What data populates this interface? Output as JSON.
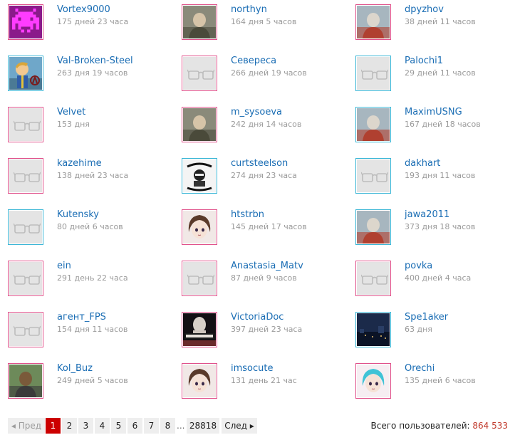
{
  "users": [
    {
      "name": "Vortex9000",
      "since": "175 дней 23 часа",
      "avatar": "pixel-invader-avatar",
      "ring": "pink"
    },
    {
      "name": "northyn",
      "since": "164 дня 5 часов",
      "avatar": "photo-avatar",
      "ring": "pink"
    },
    {
      "name": "dpyzhov",
      "since": "38 дней 11 часов",
      "avatar": "photo-avatar",
      "ring": "pink"
    },
    {
      "name": "Val-Broken-Steel",
      "since": "263 дня 19 часов",
      "avatar": "vault-boy-avatar",
      "ring": "blue"
    },
    {
      "name": "Севереса",
      "since": "266 дней 19 часов",
      "avatar": "placeholder-glasses",
      "ring": "pink"
    },
    {
      "name": "Palochi1",
      "since": "29 дней 11 часов",
      "avatar": "placeholder-glasses",
      "ring": "blue"
    },
    {
      "name": "Velvet",
      "since": "153 дня",
      "avatar": "placeholder-glasses",
      "ring": "pink"
    },
    {
      "name": "m_sysoeva",
      "since": "242 дня 14 часов",
      "avatar": "photo-avatar",
      "ring": "pink"
    },
    {
      "name": "MaximUSNG",
      "since": "167 дней 18 часов",
      "avatar": "photo-avatar",
      "ring": "blue"
    },
    {
      "name": "kazehime",
      "since": "138 дней 23 часа",
      "avatar": "placeholder-glasses",
      "ring": "pink"
    },
    {
      "name": "curtsteelson",
      "since": "274 дня 23 часа",
      "avatar": "poster-avatar",
      "ring": "blue"
    },
    {
      "name": "dakhart",
      "since": "193 дня 11 часов",
      "avatar": "placeholder-glasses",
      "ring": "blue"
    },
    {
      "name": "Kutensky",
      "since": "80 дней 6 часов",
      "avatar": "placeholder-glasses",
      "ring": "blue"
    },
    {
      "name": "htstrbn",
      "since": "145 дней 17 часов",
      "avatar": "anime-avatar",
      "ring": "pink"
    },
    {
      "name": "jawa2011",
      "since": "373 дня 18 часов",
      "avatar": "photo-avatar",
      "ring": "blue"
    },
    {
      "name": "ein",
      "since": "291 день 22 часа",
      "avatar": "placeholder-glasses",
      "ring": "pink"
    },
    {
      "name": "Anastasia_Matv",
      "since": "87 дней 9 часов",
      "avatar": "placeholder-glasses",
      "ring": "pink"
    },
    {
      "name": "povka",
      "since": "400 дней 4 часа",
      "avatar": "placeholder-glasses",
      "ring": "pink"
    },
    {
      "name": "агент_FPS",
      "since": "154 дня 11 часов",
      "avatar": "placeholder-glasses",
      "ring": "pink"
    },
    {
      "name": "VictoriaDoc",
      "since": "397 дней 23 часа",
      "avatar": "viper-avatar",
      "ring": "pink"
    },
    {
      "name": "Spe1aker",
      "since": "63 дня",
      "avatar": "night-city-avatar",
      "ring": "blue"
    },
    {
      "name": "Kol_Buz",
      "since": "249 дней 5 часов",
      "avatar": "photo-avatar",
      "ring": "pink"
    },
    {
      "name": "imsocute",
      "since": "131 день 21 час",
      "avatar": "anime-avatar",
      "ring": "pink"
    },
    {
      "name": "Orechi",
      "since": "135 дней 6 часов",
      "avatar": "anime-avatar",
      "ring": "pink"
    }
  ],
  "pagination": {
    "prev": "◂ Пред",
    "pages": [
      "1",
      "2",
      "3",
      "4",
      "5",
      "6",
      "7",
      "8"
    ],
    "current": "1",
    "ellipsis": "...",
    "last": "28818",
    "next": "След ▸"
  },
  "total": {
    "label": "Всего пользователей:",
    "value": "864 533"
  },
  "colors": {
    "link": "#1a6db4",
    "meta": "#9a9a9a",
    "ring_pink": "#e0508a",
    "ring_blue": "#3ab6d6",
    "active_page": "#cc0000",
    "total_value": "#c0392b"
  }
}
